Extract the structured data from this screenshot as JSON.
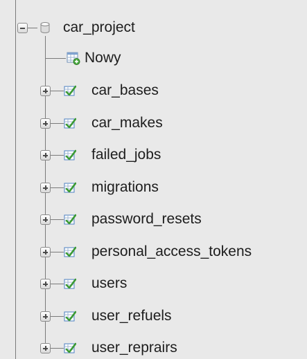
{
  "tree": {
    "database": {
      "name": "car_project",
      "icon": "database-icon",
      "expanded": true
    },
    "new_item": {
      "label": "Nowy",
      "icon": "new-table-icon"
    },
    "tables": [
      {
        "name": "car_bases",
        "icon": "table-icon",
        "expanded": false
      },
      {
        "name": "car_makes",
        "icon": "table-icon",
        "expanded": false
      },
      {
        "name": "failed_jobs",
        "icon": "table-icon",
        "expanded": false
      },
      {
        "name": "migrations",
        "icon": "table-icon",
        "expanded": false
      },
      {
        "name": "password_resets",
        "icon": "table-icon",
        "expanded": false
      },
      {
        "name": "personal_access_tokens",
        "icon": "table-icon",
        "expanded": false
      },
      {
        "name": "users",
        "icon": "table-icon",
        "expanded": false
      },
      {
        "name": "user_refuels",
        "icon": "table-icon",
        "expanded": false
      },
      {
        "name": "user_reprairs",
        "icon": "table-icon",
        "expanded": false
      }
    ]
  },
  "colors": {
    "background": "#e9e9e9",
    "tree_line": "#7a7a7a",
    "table_icon_green": "#3b9a33",
    "table_icon_blue": "#4a7fc1"
  }
}
